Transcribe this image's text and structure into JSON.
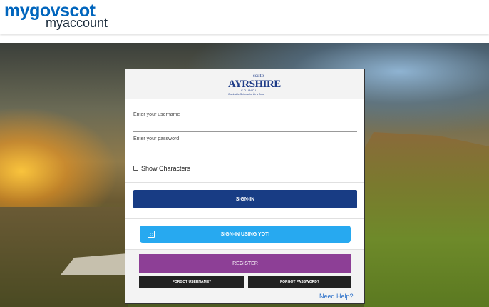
{
  "header": {
    "brand_top": "mygovscot",
    "brand_bottom": "myaccount"
  },
  "logo": {
    "south": "south",
    "main": "AYRSHIRE",
    "council": "COUNCIL",
    "tagline": "Comhairle Shiorrachd Àir a Deas"
  },
  "form": {
    "username_label": "Enter your username",
    "username_value": "",
    "password_label": "Enter your password",
    "password_value": "",
    "show_characters_label": "Show Characters",
    "show_characters_checked": false
  },
  "buttons": {
    "signin_label": "SIGN-IN",
    "yoti_label": "SIGN-IN USING YOTI",
    "register_label": "REGISTER",
    "forgot_username_label": "FORGOT USERNAME?",
    "forgot_password_label": "FORGOT PASSWORD?"
  },
  "help": {
    "link_label": "Need Help?"
  },
  "colors": {
    "brand_blue": "#0065bd",
    "signin_blue": "#183c84",
    "yoti_blue": "#27a9f0",
    "register_purple": "#8d3f96",
    "forgot_dark": "#222222",
    "help_link": "#2a6fc9"
  }
}
